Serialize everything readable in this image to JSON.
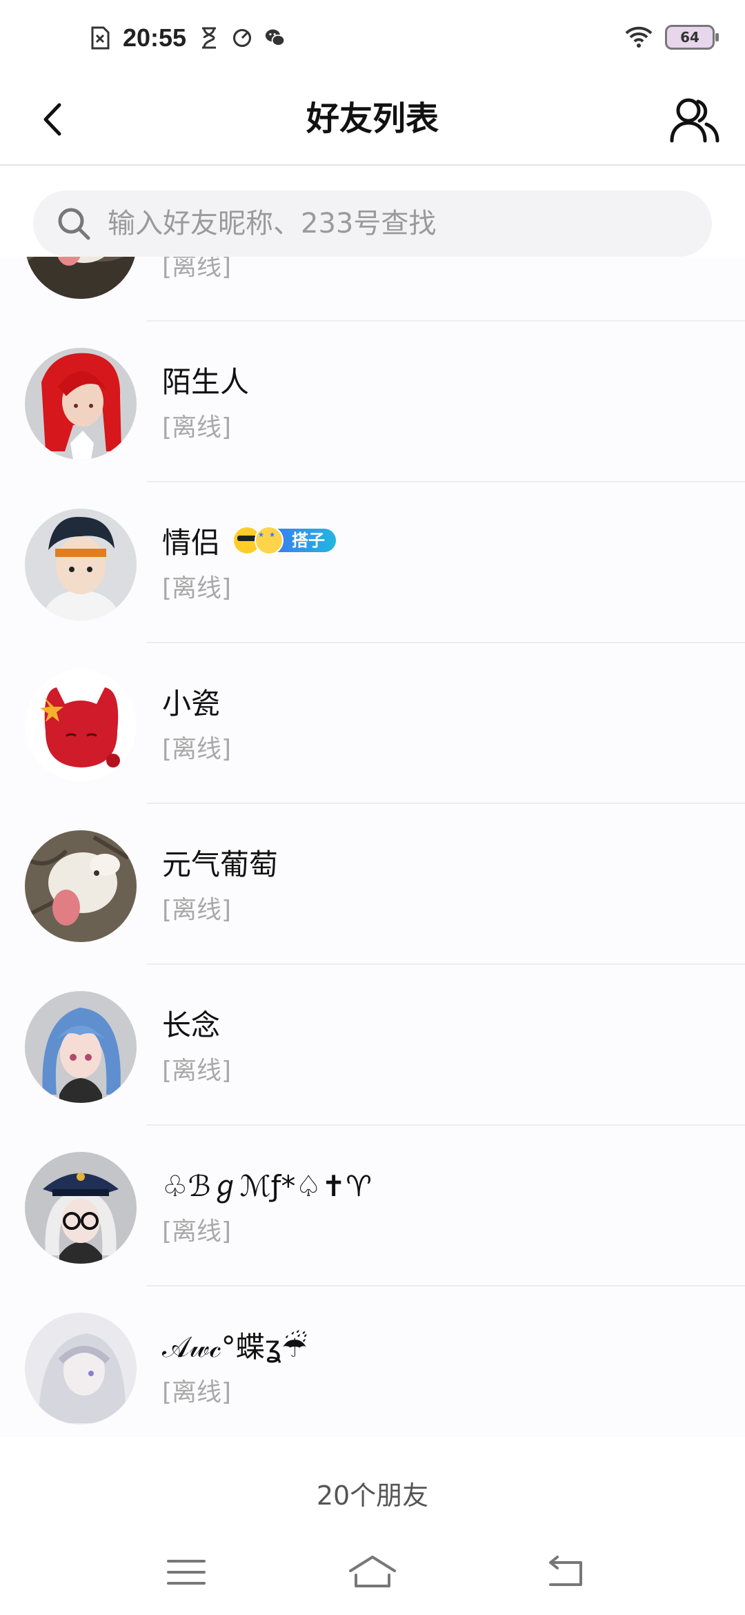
{
  "status_bar": {
    "time": "20:55",
    "battery": "64",
    "icons": [
      "sim-off-icon",
      "hourglass-icon",
      "data-saver-icon",
      "wechat-icon",
      "wifi-icon",
      "battery-icon"
    ]
  },
  "header": {
    "title": "好友列表",
    "back_icon": "chevron-left-icon",
    "friends_icon": "people-icon"
  },
  "search": {
    "placeholder": "输入好友昵称、233号查找",
    "value": "",
    "icon": "search-icon"
  },
  "friends": [
    {
      "name": "",
      "status": "[离线]",
      "avatar": "white-dog"
    },
    {
      "name": "陌生人",
      "status": "[离线]",
      "avatar": "red-hair"
    },
    {
      "name": "情侣",
      "status": "[离线]",
      "avatar": "dark-hair-boy",
      "badge": {
        "label": "搭子",
        "icons": [
          "sunglasses-emoji",
          "star-eyes-emoji"
        ]
      }
    },
    {
      "name": "小瓷",
      "status": "[离线]",
      "avatar": "red-cat"
    },
    {
      "name": "元气葡萄",
      "status": "[离线]",
      "avatar": "white-dog"
    },
    {
      "name": "长念",
      "status": "[离线]",
      "avatar": "blue-hair-girl"
    },
    {
      "name": "♧ℬℊℳƒ*♤✝♈",
      "status": "[离线]",
      "avatar": "glasses-girl"
    },
    {
      "name": "𝒜𝓌𝒸°蝶ʓ☔",
      "status": "[离线]",
      "avatar": "pale-girl"
    }
  ],
  "footer": {
    "count": "20个朋友"
  },
  "nav_bar": {
    "icons": [
      "menu-icon",
      "home-icon",
      "back-icon"
    ]
  }
}
